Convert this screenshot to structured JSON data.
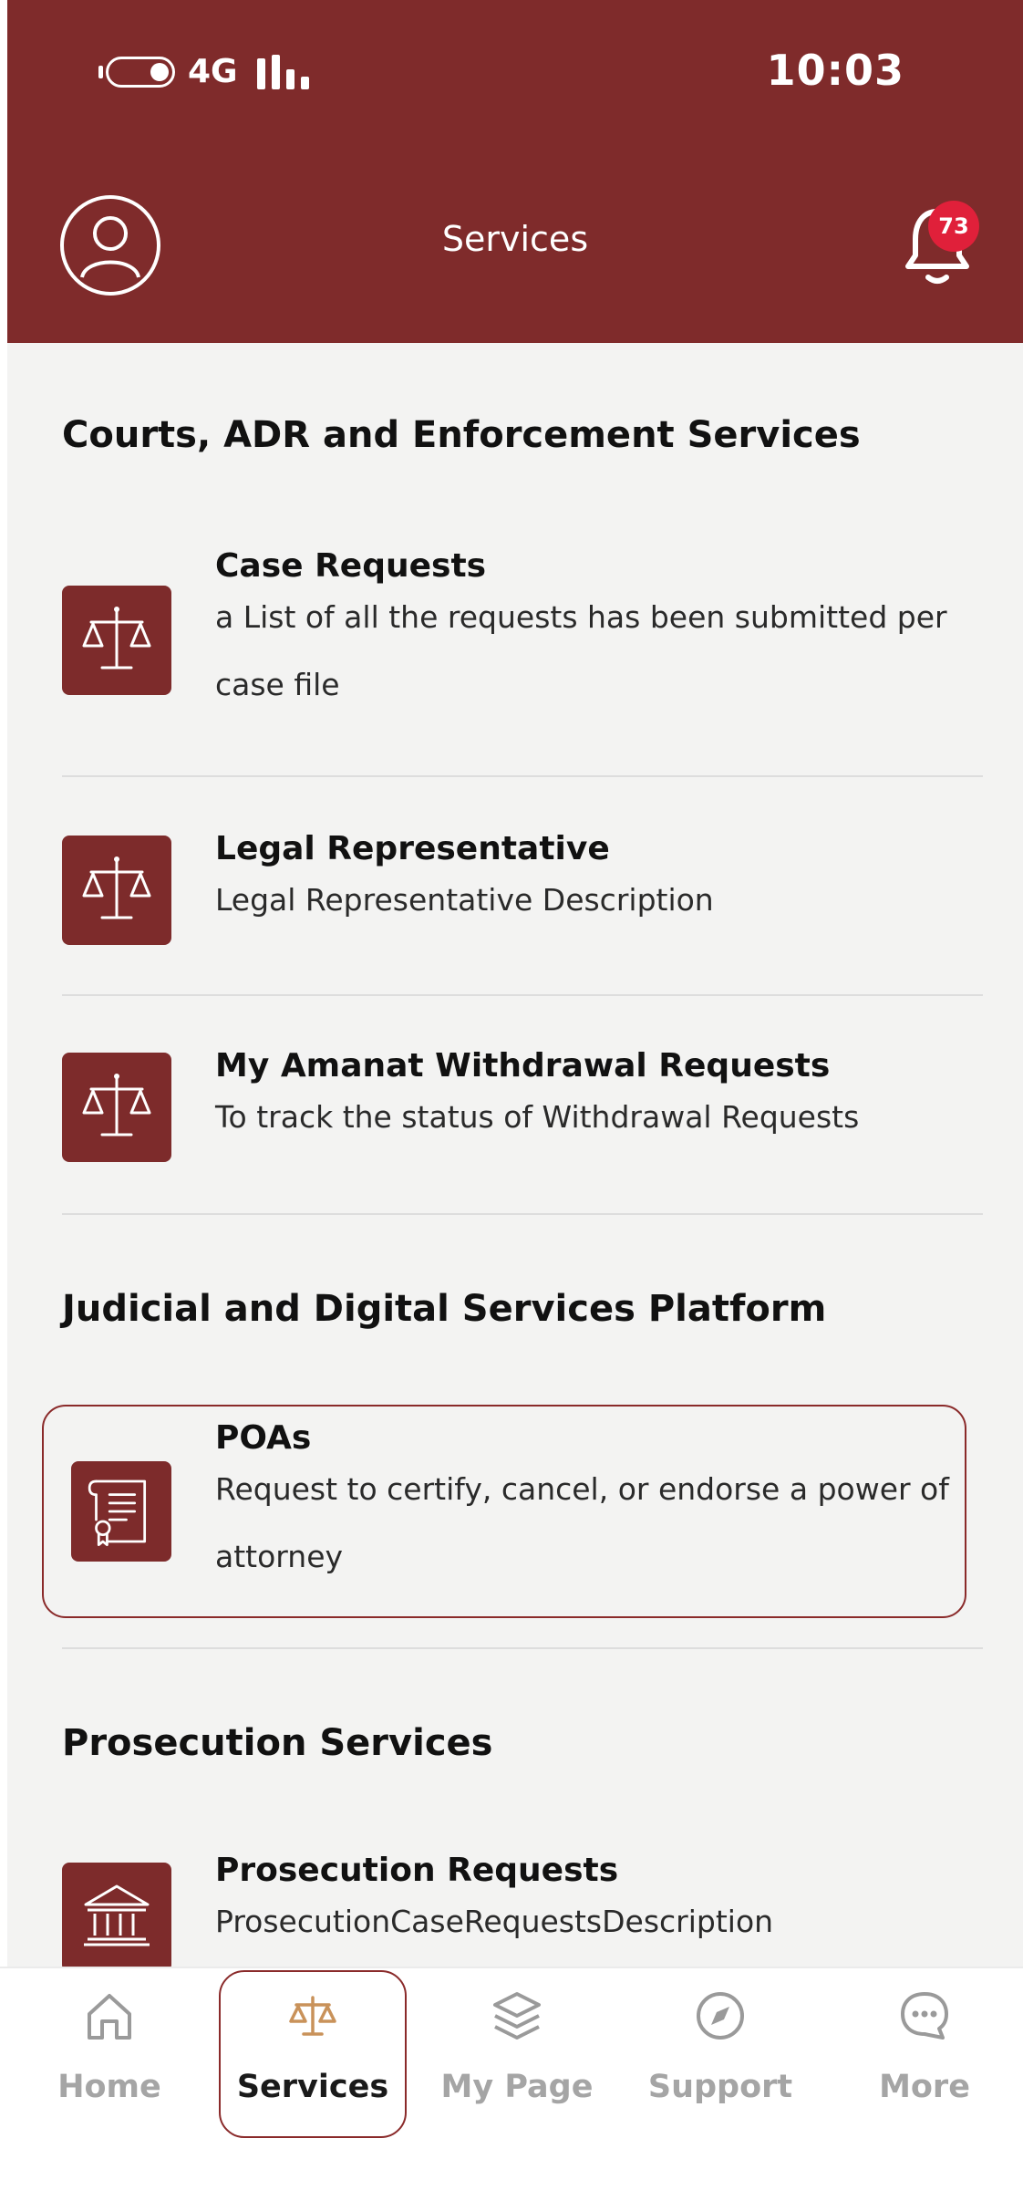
{
  "status_bar": {
    "network": "4G",
    "time": "10:03"
  },
  "header": {
    "title": "Services",
    "notification_count": "73"
  },
  "sections": [
    {
      "title": "Courts, ADR and Enforcement Services",
      "items": [
        {
          "title": "Case Requests",
          "desc_line1": "a List of all the requests has been submitted per",
          "desc_line2": "case file",
          "icon": "scales-icon"
        },
        {
          "title": "Legal Representative",
          "desc_line1": "Legal Representative Description",
          "icon": "scales-icon"
        },
        {
          "title": "My Amanat Withdrawal Requests",
          "desc_line1": "To track the status of Withdrawal Requests",
          "icon": "scales-icon"
        }
      ]
    },
    {
      "title": "Judicial and Digital Services Platform",
      "items": [
        {
          "title": "POAs",
          "desc_line1": "Request to certify, cancel, or endorse a power of",
          "desc_line2": "attorney",
          "icon": "certificate-icon"
        }
      ]
    },
    {
      "title": "Prosecution Services",
      "items": [
        {
          "title": "Prosecution Requests",
          "desc_line1": "ProsecutionCaseRequestsDescription",
          "icon": "courthouse-icon"
        }
      ]
    }
  ],
  "tabs": [
    {
      "label": "Home",
      "icon": "home-icon"
    },
    {
      "label": "Services",
      "icon": "scales-icon",
      "active": true
    },
    {
      "label": "My Page",
      "icon": "layers-icon"
    },
    {
      "label": "Support",
      "icon": "compass-icon"
    },
    {
      "label": "More",
      "icon": "chat-dots-icon"
    }
  ],
  "colors": {
    "brand": "#7f2b2b",
    "badge": "#e0203a",
    "active_tab_icon": "#c9925a",
    "inactive": "#a5a5a5"
  }
}
